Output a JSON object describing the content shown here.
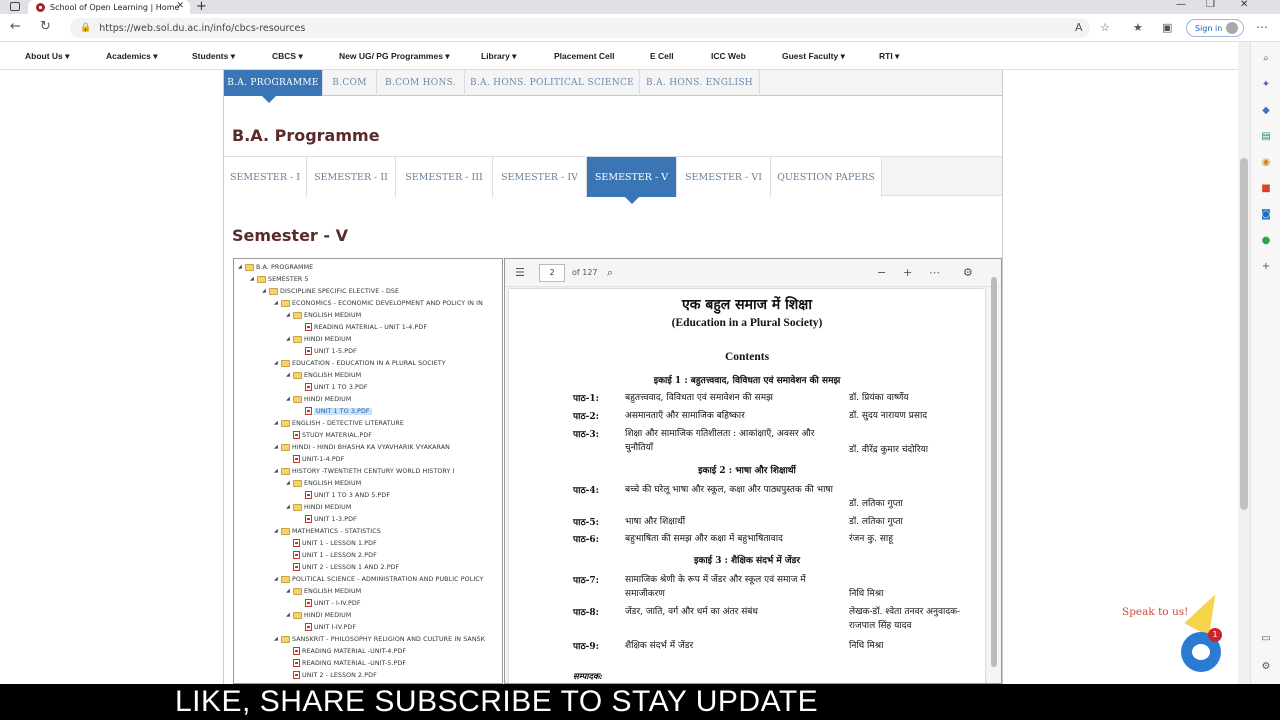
{
  "browser": {
    "tab_title": "School of Open Learning | Home",
    "url": "https://web.sol.du.ac.in/info/cbcs-resources",
    "signin_label": "Sign in"
  },
  "sitenav": {
    "items": [
      "About Us ▾",
      "Academics ▾",
      "Students ▾",
      "CBCS ▾",
      "New UG/ PG Programmes ▾",
      "Library ▾",
      "Placement Cell",
      "E Cell",
      "ICC Web",
      "Guest Faculty ▾",
      "RTI ▾"
    ]
  },
  "programmes": {
    "tabs": [
      "B.A. PROGRAMME",
      "B.COM",
      "B.COM HONS.",
      "B.A. HONS. POLITICAL SCIENCE",
      "B.A. HONS. ENGLISH"
    ],
    "heading": "B.A. Programme"
  },
  "semesters": {
    "tabs": [
      "SEMESTER - I",
      "SEMESTER - II",
      "SEMESTER - III",
      "SEMESTER - IV",
      "SEMESTER - V",
      "SEMESTER - VI",
      "QUESTION PAPERS"
    ],
    "heading": "Semester - V"
  },
  "tree": [
    {
      "label": "B.A. PROGRAMME",
      "type": "folder"
    },
    {
      "label": "SEMESTER 5",
      "type": "folder"
    },
    {
      "label": "DISCIPLINE SPECIFIC ELECTIVE - DSE",
      "type": "folder"
    },
    {
      "label": "ECONOMICS - ECONOMIC DEVELOPMENT AND POLICY IN IN",
      "type": "folder"
    },
    {
      "label": "ENGLISH MEDIUM",
      "type": "folder"
    },
    {
      "label": "READING MATERIAL - UNIT 1-4.PDF",
      "type": "pdf"
    },
    {
      "label": "HINDI MEDIUM",
      "type": "folder"
    },
    {
      "label": "UNIT 1-5.PDF",
      "type": "pdf"
    },
    {
      "label": "EDUCATION - EDUCATION IN A PLURAL SOCIETY",
      "type": "folder"
    },
    {
      "label": "ENGLISH MEDIUM",
      "type": "folder"
    },
    {
      "label": "UNIT 1 TO 3.PDF",
      "type": "pdf"
    },
    {
      "label": "HINDI MEDIUM",
      "type": "folder"
    },
    {
      "label": "UNIT 1 TO 3.PDF",
      "type": "pdf",
      "selected": true
    },
    {
      "label": "ENGLISH - DETECTIVE LITERATURE",
      "type": "folder"
    },
    {
      "label": "STUDY MATERIAL.PDF",
      "type": "pdf"
    },
    {
      "label": "HINDI - HINDI BHASHA KA VYAVHARIK VYAKARAN",
      "type": "folder"
    },
    {
      "label": "UNIT-1-4.PDF",
      "type": "pdf"
    },
    {
      "label": "HISTORY -TWENTIETH CENTURY WORLD HISTORY I",
      "type": "folder"
    },
    {
      "label": "ENGLISH MEDIUM",
      "type": "folder"
    },
    {
      "label": "UNIT 1 TO 3 AND 5.PDF",
      "type": "pdf"
    },
    {
      "label": "HINDI MEDIUM",
      "type": "folder"
    },
    {
      "label": "UNIT 1-3.PDF",
      "type": "pdf"
    },
    {
      "label": "MATHEMATICS - STATISTICS",
      "type": "folder"
    },
    {
      "label": "UNIT 1 - LESSON 1.PDF",
      "type": "pdf"
    },
    {
      "label": "UNIT 1 - LESSON 2.PDF",
      "type": "pdf"
    },
    {
      "label": "UNIT 2 - LESSON 1 AND 2.PDF",
      "type": "pdf"
    },
    {
      "label": "POLITICAL SCIENCE - ADMINISTRATION AND PUBLIC POLICY",
      "type": "folder"
    },
    {
      "label": "ENGLISH MEDIUM",
      "type": "folder"
    },
    {
      "label": "UNIT - I-IV.PDF",
      "type": "pdf"
    },
    {
      "label": "HINDI MEDIUM",
      "type": "folder"
    },
    {
      "label": "UNIT I-IV.PDF",
      "type": "pdf"
    },
    {
      "label": "SANSKRIT - PHILOSOPHY RELIGION AND CULTURE IN SANSK",
      "type": "folder"
    },
    {
      "label": "READING MATERIAL -UNIT-4.PDF",
      "type": "pdf"
    },
    {
      "label": "READING MATERIAL -UNIT-5.PDF",
      "type": "pdf"
    },
    {
      "label": "UNIT 2 - LESSON 2.PDF",
      "type": "pdf"
    }
  ],
  "pdf": {
    "page": "2",
    "of_pages": "of 127",
    "title_hi": "एक बहुल समाज में शिक्षा",
    "title_en": "(Education in a Plural Society)",
    "contents": "Contents",
    "unit1": "इकाई 1 : बहुतत्त्ववाद, विविधता एवं समावेशन की समझ",
    "unit2": "इकाई 2 : भाषा और शिक्षार्थी",
    "unit3": "इकाई 3 : शैक्षिक संदर्भ में जेंडर",
    "lessons": [
      {
        "no": "पाठ-1:",
        "title": "बहुतत्त्ववाद, विविधता एवं समावेशन की समझ",
        "author": "डॉ. प्रियंका वार्ष्णेय"
      },
      {
        "no": "पाठ-2:",
        "title": "असमानताएँ और सामाजिक बहिष्कार",
        "author": "डॉ. सुदय नारायण प्रसाद"
      },
      {
        "no": "पाठ-3:",
        "title": "शिक्षा और सामाजिक गतिशीलता : आकांक्षाएँ, अवसर और चुनौतियाँ",
        "author": "डॉ. वीरेंद्र कुमार चंदोरिया"
      },
      {
        "no": "पाठ-4:",
        "title": "बच्चे की घरेलू भाषा और स्कूल, कक्षा और पाठ्यपुस्तक की भाषा",
        "author": "डॉ. लतिका गुप्ता"
      },
      {
        "no": "पाठ-5:",
        "title": "भाषा और शिक्षार्थी",
        "author": "डॉ. लतिका गुप्ता"
      },
      {
        "no": "पाठ-6:",
        "title": "बहुभाषिता की समझ और कक्षा में बहुभाषितावाद",
        "author": "रंजन कु. साहू"
      },
      {
        "no": "पाठ-7:",
        "title": "सामाजिक श्रेणी के रूप में जेंडर और स्कूल एवं समाज में समाजीकरण",
        "author": "निधि मिश्रा"
      },
      {
        "no": "पाठ-8:",
        "title": "जेंडर, जाति, वर्ग और धर्म का अंतर संबंध",
        "author": "लेखक-डॉ. श्वेता तनवर अनुवादक-राजपाल सिंह यादव"
      },
      {
        "no": "पाठ-9:",
        "title": "शैक्षिक संदर्भ में जेंडर",
        "author": "निधि मिश्रा"
      }
    ],
    "editor_label": "सम्पादक:"
  },
  "chat": {
    "speak_label": "Speak to us!",
    "badge": "1"
  },
  "banner": {
    "text": "LIKE, SHARE SUBSCRIBE TO STAY UPDATE"
  }
}
